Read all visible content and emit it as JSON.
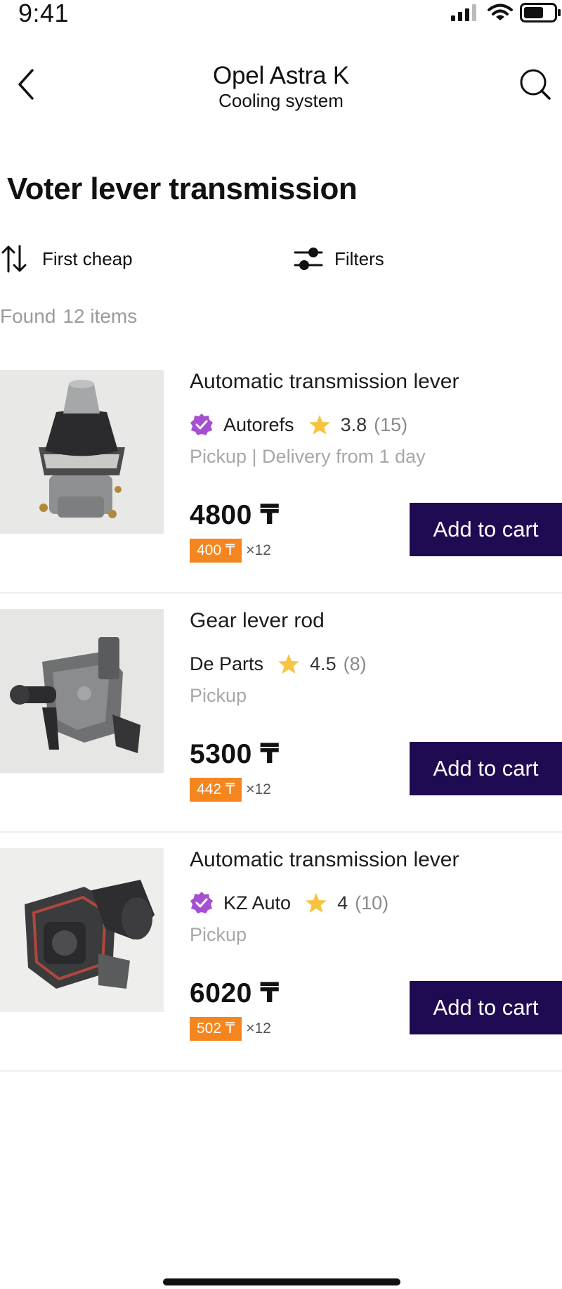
{
  "status_bar": {
    "time": "9:41"
  },
  "nav": {
    "title": "Opel Astra K",
    "subtitle": "Cooling system"
  },
  "page": {
    "title": "Voter lever transmission"
  },
  "toolbar": {
    "sort_label": "First cheap",
    "filter_label": "Filters"
  },
  "results": {
    "found_label": "Found",
    "count_text": "12 items"
  },
  "products": [
    {
      "title": "Automatic transmission lever",
      "seller": "Autorefs",
      "verified": true,
      "rating": "3.8",
      "reviews": "(15)",
      "delivery": "Pickup | Delivery from 1 day",
      "price": "4800 ₸",
      "installment": "400 ₸",
      "installment_multiplier": "×12",
      "cart_label": "Add to cart",
      "image_icon": "transmission-lever-photo"
    },
    {
      "title": "Gear lever rod",
      "seller": "De Parts",
      "verified": false,
      "rating": "4.5",
      "reviews": "(8)",
      "delivery": "Pickup",
      "price": "5300 ₸",
      "installment": "442 ₸",
      "installment_multiplier": "×12",
      "cart_label": "Add to cart",
      "image_icon": "gear-lever-rod-photo"
    },
    {
      "title": "Automatic transmission lever",
      "seller": "KZ Auto",
      "verified": true,
      "rating": "4",
      "reviews": "(10)",
      "delivery": "Pickup",
      "price": "6020 ₸",
      "installment": "502 ₸",
      "installment_multiplier": "×12",
      "cart_label": "Add to cart",
      "image_icon": "transmission-mount-photo"
    }
  ],
  "colors": {
    "accent_dark": "#1f0b52",
    "installment_orange": "#f5861f",
    "verified_purple": "#a64fd2",
    "star_yellow": "#f6c343"
  }
}
